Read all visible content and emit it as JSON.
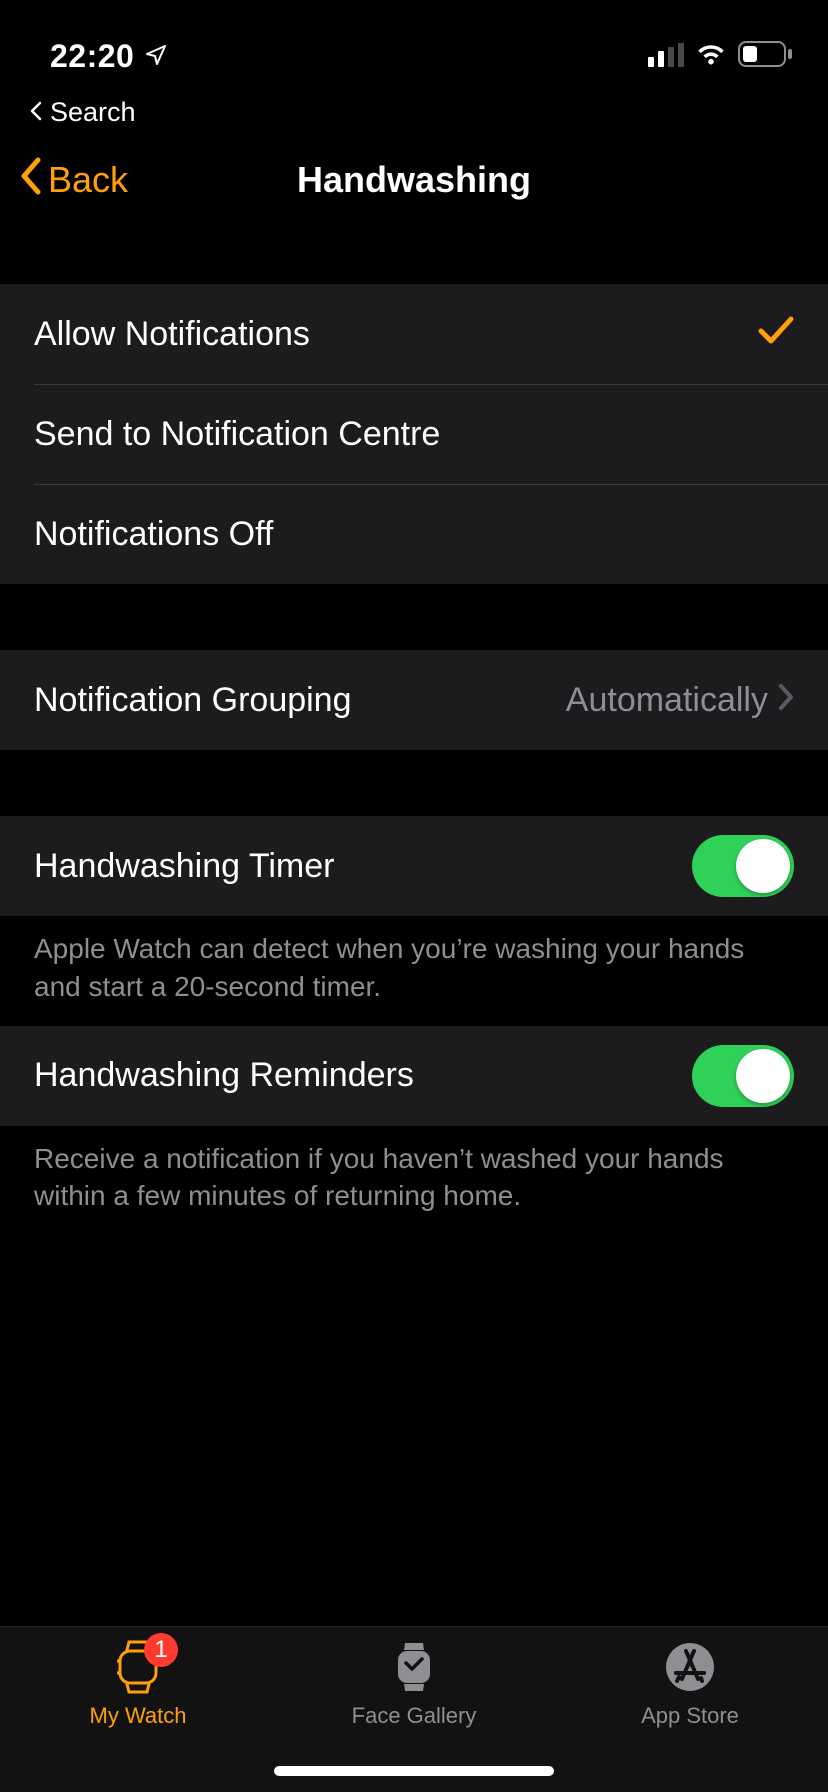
{
  "status": {
    "time": "22:20",
    "breadcrumb": "Search"
  },
  "nav": {
    "back": "Back",
    "title": "Handwashing"
  },
  "notif_options": {
    "allow": "Allow Notifications",
    "send_centre": "Send to Notification Centre",
    "off": "Notifications Off"
  },
  "grouping": {
    "label": "Notification Grouping",
    "value": "Automatically"
  },
  "timer": {
    "label": "Handwashing Timer",
    "desc": "Apple Watch can detect when you’re washing your hands and start a 20-second timer."
  },
  "reminders": {
    "label": "Handwashing Reminders",
    "desc": "Receive a notification if you haven’t washed your hands within a few minutes of returning home."
  },
  "tabs": {
    "my_watch": "My Watch",
    "my_watch_badge": "1",
    "face_gallery": "Face Gallery",
    "app_store": "App Store"
  }
}
